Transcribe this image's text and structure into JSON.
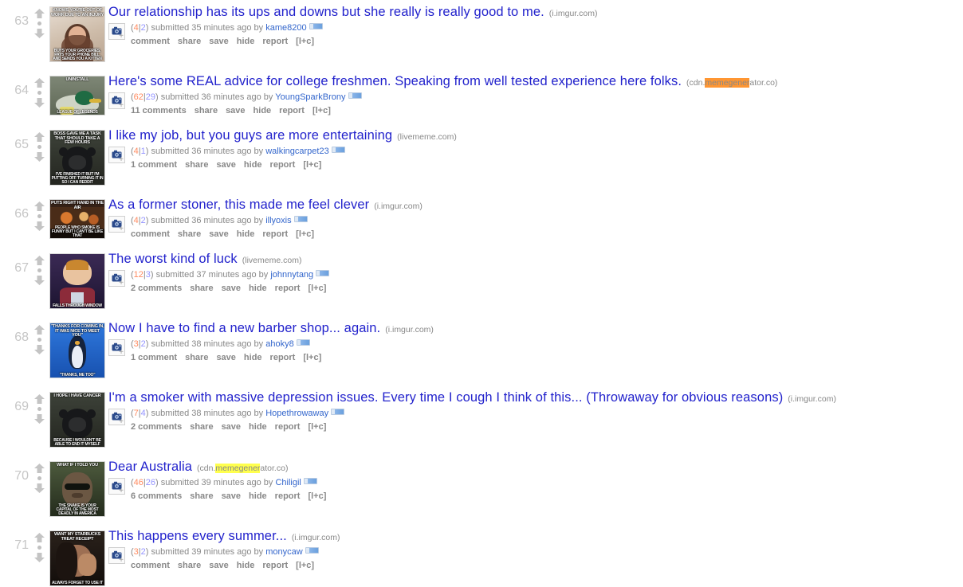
{
  "listing": {
    "posts": [
      {
        "rank": "63",
        "title": "Our relationship has its ups and downs but she really is really good to me.",
        "domain": "(i.imgur.com)",
        "domain_highlight": null,
        "score_up": "4",
        "score_sep": "|",
        "score_down": "2",
        "submitted": "submitted 35 minutes ago by",
        "author": "kame8200",
        "comments": "comment",
        "share": "share",
        "save": "save",
        "hide": "hide",
        "report": "report",
        "lplusc": "[l+c]",
        "thumb": {
          "top": "KNOWS YOU'RE OUT OF WORK DUE TO AN INJURY",
          "bottom": "BUYS YOUR GROCERIES, PAYS YOUR PHONE BILL, AND SENDS YOU A KITTEN",
          "mid": "",
          "bg": "#c9a98f",
          "style": "photo-woman"
        }
      },
      {
        "rank": "64",
        "title": "Here's some REAL advice for college freshmen. Speaking from well tested experience here folks.",
        "domain": "(cdn.memegenerator.co)",
        "domain_highlight": {
          "before": "(cdn.",
          "marked": "memegener",
          "after": "ator.co)",
          "color": "orange"
        },
        "score_up": "62",
        "score_sep": "|",
        "score_down": "29",
        "submitted": "submitted 36 minutes ago by",
        "author": "YoungSparkBrony",
        "comments": "11 comments",
        "share": "share",
        "save": "save",
        "hide": "hide",
        "report": "report",
        "lplusc": "[l+c]",
        "thumb": {
          "top": "UNINSTALL",
          "bottom": "LEAGUE OF LEGENDS",
          "mid": "",
          "bg": "#6d7560",
          "style": "photo-duck"
        }
      },
      {
        "rank": "65",
        "title": "I like my job, but you guys are more entertaining",
        "domain": "(livememe.com)",
        "domain_highlight": null,
        "score_up": "4",
        "score_sep": "|",
        "score_down": "1",
        "submitted": "submitted 36 minutes ago by",
        "author": "walkingcarpet23",
        "comments": "1 comment",
        "share": "share",
        "save": "save",
        "hide": "hide",
        "report": "report",
        "lplusc": "[l+c]",
        "thumb": {
          "top": "BOSS GAVE ME A TASK THAT SHOULD TAKE A FEW HOURS",
          "bottom": "I'VE FINISHED IT BUT I'M PUTTING OFF TURNING IT IN SO I CAN REDDIT",
          "mid": "",
          "bg": "#3b3a36",
          "style": "photo-bear"
        }
      },
      {
        "rank": "66",
        "title": "As a former stoner, this made me feel clever",
        "domain": "(i.imgur.com)",
        "domain_highlight": null,
        "score_up": "4",
        "score_sep": "|",
        "score_down": "2",
        "submitted": "submitted 36 minutes ago by",
        "author": "illyoxis",
        "comments": "comment",
        "share": "share",
        "save": "save",
        "hide": "hide",
        "report": "report",
        "lplusc": "[l+c]",
        "thumb": {
          "top": "PUTS RIGHT HAND IN THE AIR",
          "bottom": "PEOPLE WHO SMOKE IS FUNNY BUT I CAN'T BE LIKE THAT",
          "mid": "",
          "bg": "#b05a2c",
          "style": "photo-crowd"
        }
      },
      {
        "rank": "67",
        "title": "The worst kind of luck",
        "domain": "(livememe.com)",
        "domain_highlight": null,
        "score_up": "12",
        "score_sep": "|",
        "score_down": "3",
        "submitted": "submitted 37 minutes ago by",
        "author": "johnnytang",
        "comments": "2 comments",
        "share": "share",
        "save": "save",
        "hide": "hide",
        "report": "report",
        "lplusc": "[l+c]",
        "thumb": {
          "top": "",
          "bottom": "FALLS THROUGH WINDOW",
          "mid": "",
          "bg": "#2b1d3a",
          "style": "photo-brian"
        }
      },
      {
        "rank": "68",
        "title": "Now I have to find a new barber shop... again.",
        "domain": "(i.imgur.com)",
        "domain_highlight": null,
        "score_up": "3",
        "score_sep": "|",
        "score_down": "2",
        "submitted": "submitted 38 minutes ago by",
        "author": "ahoky8",
        "comments": "1 comment",
        "share": "share",
        "save": "save",
        "hide": "hide",
        "report": "report",
        "lplusc": "[l+c]",
        "thumb": {
          "top": "\"THANKS FOR COMING IN, IT WAS NICE TO MEET YOU\"",
          "bottom": "\"THANKS, ME TOO\"",
          "mid": "",
          "bg": "#1f5fc4",
          "style": "photo-penguin"
        }
      },
      {
        "rank": "69",
        "title": "I'm a smoker with massive depression issues. Every time I cough I think of this... (Throwaway for obvious reasons)",
        "domain": "(i.imgur.com)",
        "domain_highlight": null,
        "score_up": "7",
        "score_sep": "|",
        "score_down": "4",
        "submitted": "submitted 38 minutes ago by",
        "author": "Hopethrowaway",
        "comments": "2 comments",
        "share": "share",
        "save": "save",
        "hide": "hide",
        "report": "report",
        "lplusc": "[l+c]",
        "thumb": {
          "top": "I HOPE I HAVE CANCER",
          "bottom": "BECAUSE I WOULDN'T BE ABLE TO END IT MYSELF",
          "mid": "",
          "bg": "#4a4b45",
          "style": "photo-bear"
        }
      },
      {
        "rank": "70",
        "title": "Dear Australia",
        "domain": "(cdn.memegenerator.co)",
        "domain_highlight": {
          "before": "(cdn.",
          "marked": "memegener",
          "after": "ator.co)",
          "color": "yellow"
        },
        "score_up": "46",
        "score_sep": "|",
        "score_down": "26",
        "submitted": "submitted 39 minutes ago by",
        "author": "Chiligil",
        "comments": "6 comments",
        "share": "share",
        "save": "save",
        "hide": "hide",
        "report": "report",
        "lplusc": "[l+c]",
        "thumb": {
          "top": "WHAT IF I TOLD YOU",
          "bottom": "THE SNAKE IS YOUR CAPITAL OF THE MOST DEADLY IN AMERICA",
          "mid": "",
          "bg": "#33402f",
          "style": "photo-morpheus"
        }
      },
      {
        "rank": "71",
        "title": "This happens every summer...",
        "domain": "(i.imgur.com)",
        "domain_highlight": null,
        "score_up": "3",
        "score_sep": "|",
        "score_down": "2",
        "submitted": "submitted 39 minutes ago by",
        "author": "monycaw",
        "comments": "comment",
        "share": "share",
        "save": "save",
        "hide": "hide",
        "report": "report",
        "lplusc": "[l+c]",
        "thumb": {
          "top": "WANT MY STARBUCKS TREAT RECEIPT",
          "bottom": "ALWAYS FORGET TO USE IT",
          "mid": "",
          "bg": "#241c16",
          "style": "photo-facepalm"
        }
      }
    ]
  },
  "colors": {
    "title_link": "#2222cc",
    "author_link": "#3366cc",
    "score_up": "#ff8b60",
    "score_down": "#9494ff",
    "meta_gray": "#888888",
    "rank_gray": "#c6c6c6",
    "highlight_orange": "#ff9632",
    "highlight_yellow": "#ffff4d"
  },
  "icons": {
    "upvote": "upvote-arrow",
    "downvote": "downvote-arrow",
    "expand": "camera-icon",
    "flair": "user-flair-badge"
  }
}
